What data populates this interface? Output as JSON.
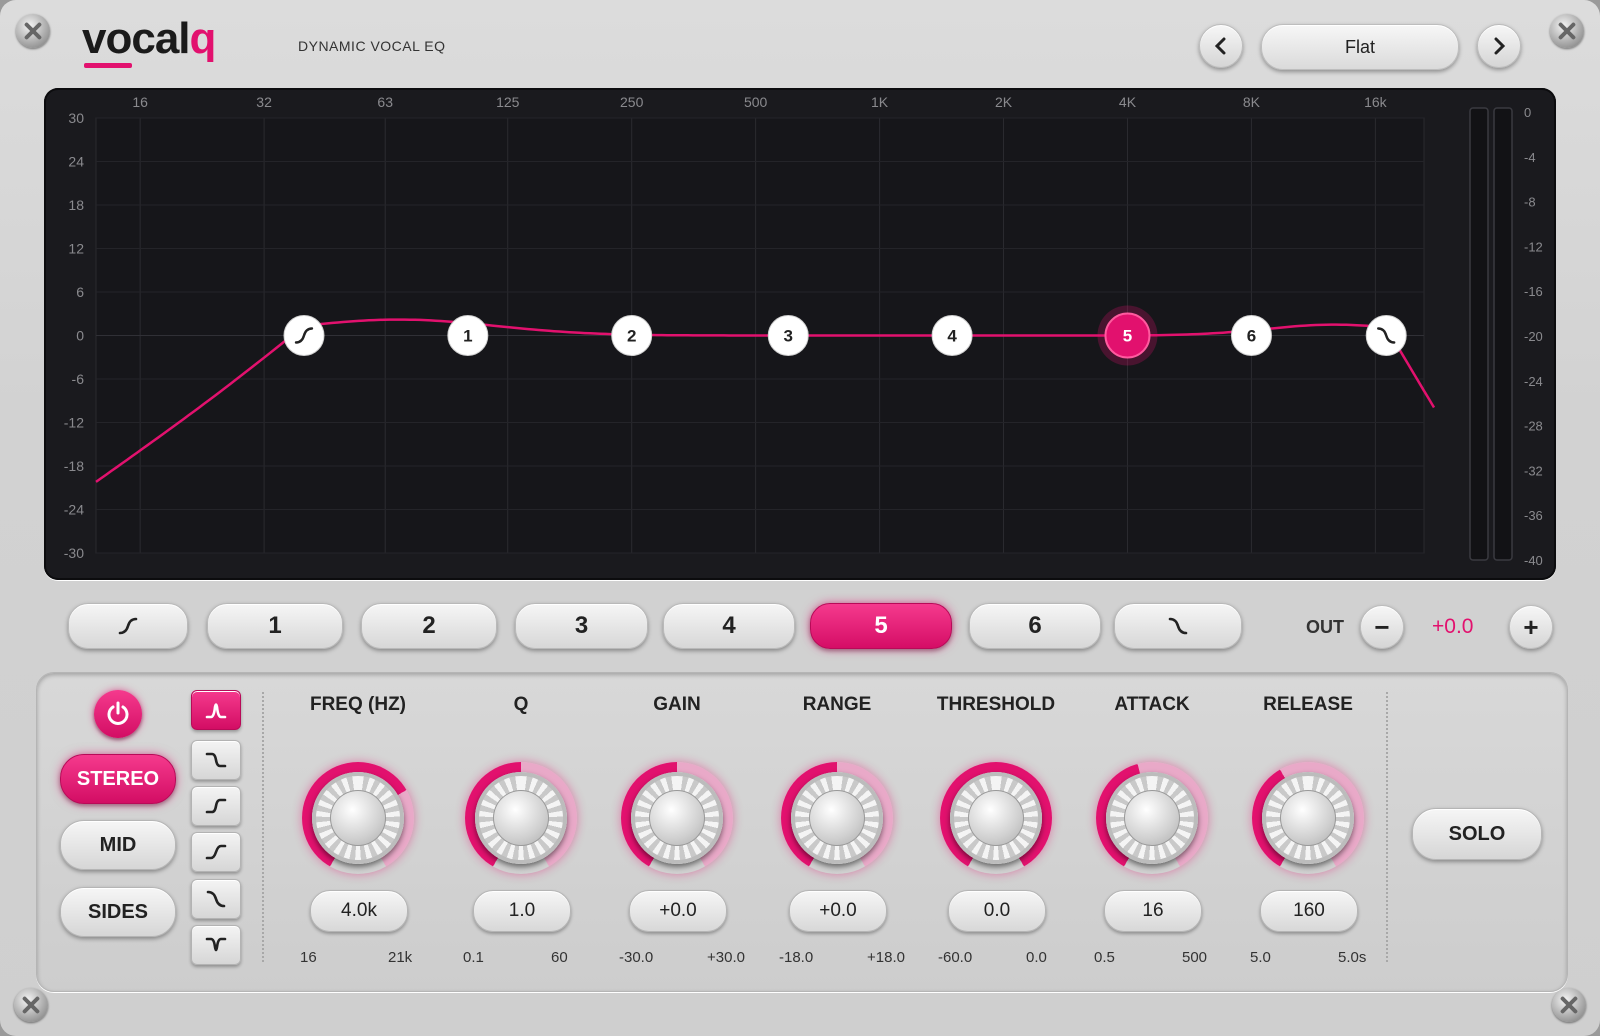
{
  "header": {
    "logo_main": "vocal",
    "logo_accent": "q",
    "subtitle": "DYNAMIC VOCAL EQ",
    "preset": "Flat",
    "prev_icon": "chevron-left-icon",
    "next_icon": "chevron-right-icon"
  },
  "colors": {
    "accent": "#e2116e",
    "display_bg": "#1a1a1e",
    "panel": "#d4d4d4"
  },
  "eq_display": {
    "freq_labels": [
      "16",
      "32",
      "63",
      "125",
      "250",
      "500",
      "1K",
      "2K",
      "4K",
      "8K",
      "16k"
    ],
    "gain_labels": [
      "30",
      "24",
      "18",
      "12",
      "6",
      "0",
      "-6",
      "-12",
      "-18",
      "-24",
      "-30"
    ],
    "meter_labels": [
      "0",
      "-4",
      "-8",
      "-12",
      "-16",
      "-20",
      "-24",
      "-28",
      "-32",
      "-36",
      "-40"
    ],
    "nodes": [
      {
        "label": "",
        "icon": "high-pass-icon",
        "freq": 40,
        "gain": 0
      },
      {
        "label": "1",
        "freq": 100,
        "gain": 0
      },
      {
        "label": "2",
        "freq": 250,
        "gain": 0
      },
      {
        "label": "3",
        "freq": 600,
        "gain": 0
      },
      {
        "label": "4",
        "freq": 1500,
        "gain": 0
      },
      {
        "label": "5",
        "freq": 4000,
        "gain": 0,
        "active": true
      },
      {
        "label": "6",
        "freq": 8000,
        "gain": 0
      },
      {
        "label": "",
        "icon": "low-pass-icon",
        "freq": 17000,
        "gain": 0
      }
    ]
  },
  "band_buttons": [
    {
      "label": "",
      "icon": "high-pass-icon"
    },
    {
      "label": "1"
    },
    {
      "label": "2"
    },
    {
      "label": "3"
    },
    {
      "label": "4"
    },
    {
      "label": "5",
      "active": true
    },
    {
      "label": "6"
    },
    {
      "label": "",
      "icon": "low-pass-icon"
    }
  ],
  "output": {
    "label": "OUT",
    "value": "+0.0",
    "minus": "−",
    "plus": "+"
  },
  "band_panel": {
    "power_icon": "power-icon",
    "modes": [
      {
        "label": "STEREO",
        "active": true
      },
      {
        "label": "MID"
      },
      {
        "label": "SIDES"
      }
    ],
    "shapes": [
      {
        "icon": "bell-icon",
        "active": true
      },
      {
        "icon": "high-shelf-down-icon"
      },
      {
        "icon": "low-shelf-icon"
      },
      {
        "icon": "high-shelf-icon"
      },
      {
        "icon": "low-pass-icon"
      },
      {
        "icon": "notch-icon"
      }
    ],
    "params": [
      {
        "label": "FREQ (HZ)",
        "value": "4.0k",
        "min": "16",
        "max": "21k",
        "level": 0.7
      },
      {
        "label": "Q",
        "value": "1.0",
        "min": "0.1",
        "max": "60",
        "level": 0.5
      },
      {
        "label": "GAIN",
        "value": "+0.0",
        "min": "-30.0",
        "max": "+30.0",
        "level": 0.5
      },
      {
        "label": "RANGE",
        "value": "+0.0",
        "min": "-18.0",
        "max": "+18.0",
        "level": 0.5
      },
      {
        "label": "THRESHOLD",
        "value": "0.0",
        "min": "-60.0",
        "max": "0.0",
        "level": 1.0
      },
      {
        "label": "ATTACK",
        "value": "16",
        "min": "0.5",
        "max": "500",
        "level": 0.45
      },
      {
        "label": "RELEASE",
        "value": "160",
        "min": "5.0",
        "max": "5.0s",
        "level": 0.4
      }
    ],
    "solo": "SOLO"
  }
}
